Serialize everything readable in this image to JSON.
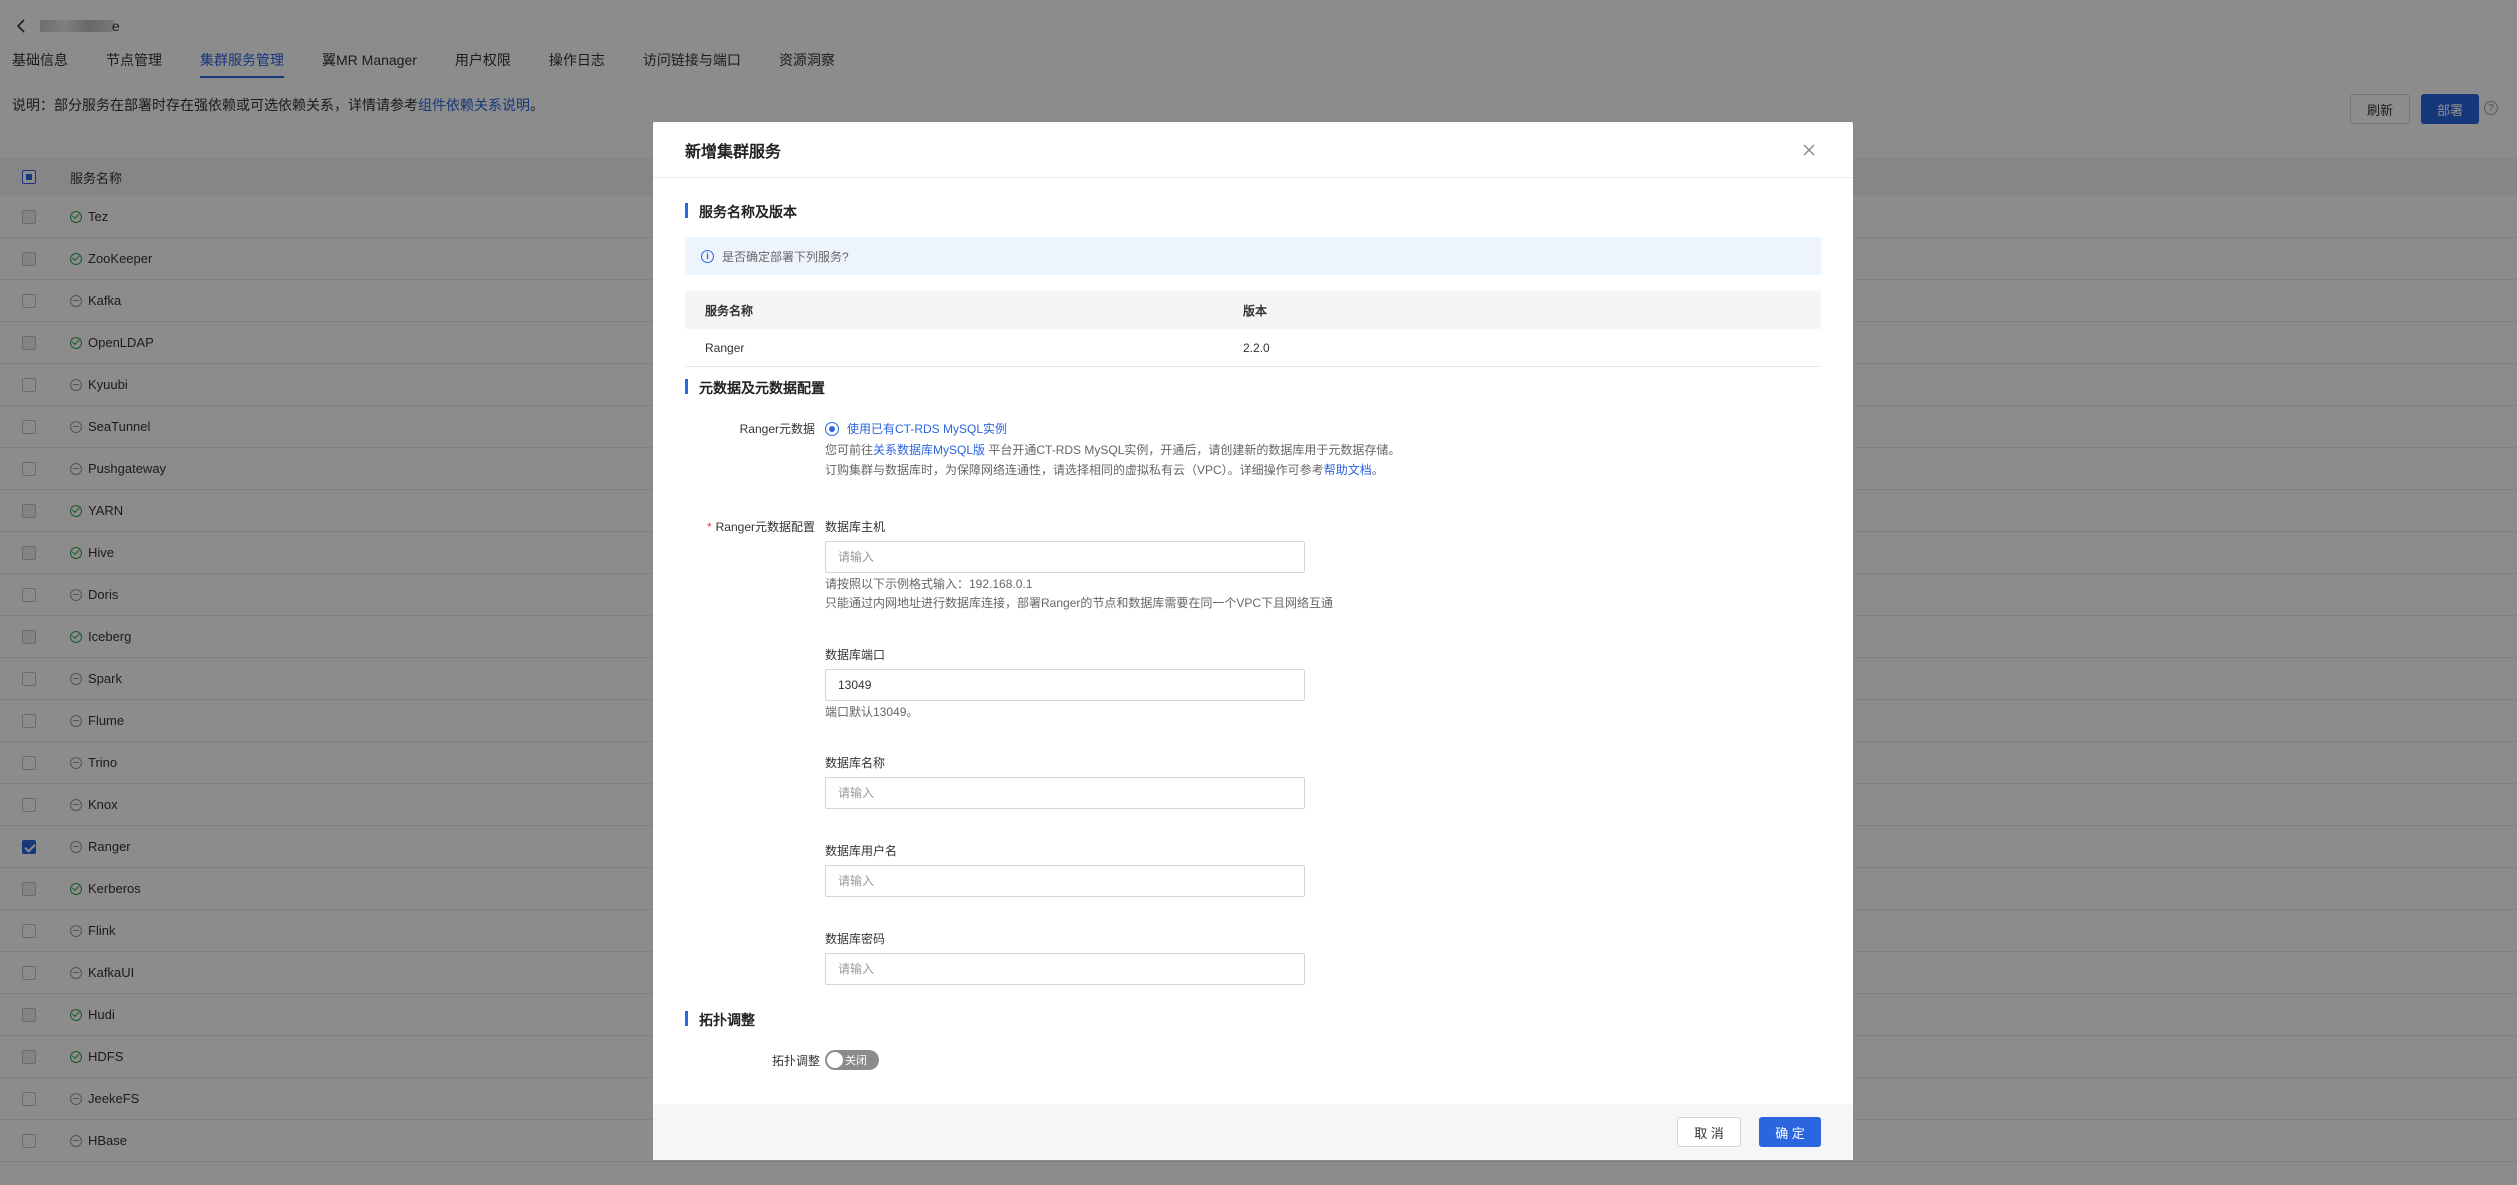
{
  "page": {
    "title_masked": "e",
    "tabs": [
      "基础信息",
      "节点管理",
      "集群服务管理",
      "翼MR Manager",
      "用户权限",
      "操作日志",
      "访问链接与端口",
      "资源洞察"
    ],
    "active_tab_index": 2,
    "description_prefix": "说明：部分服务在部署时存在强依赖或可选依赖关系，详情请参考",
    "description_link": "组件依赖关系说明",
    "description_suffix": "。",
    "refresh_label": "刷新",
    "deploy_label": "部署",
    "table_header": "服务名称",
    "services": [
      {
        "name": "Tez",
        "status": "ok",
        "checkbox": "disabled"
      },
      {
        "name": "ZooKeeper",
        "status": "ok",
        "checkbox": "disabled"
      },
      {
        "name": "Kafka",
        "status": "off",
        "checkbox": "empty"
      },
      {
        "name": "OpenLDAP",
        "status": "ok",
        "checkbox": "disabled"
      },
      {
        "name": "Kyuubi",
        "status": "off",
        "checkbox": "empty"
      },
      {
        "name": "SeaTunnel",
        "status": "off",
        "checkbox": "empty"
      },
      {
        "name": "Pushgateway",
        "status": "off",
        "checkbox": "empty"
      },
      {
        "name": "YARN",
        "status": "ok",
        "checkbox": "disabled"
      },
      {
        "name": "Hive",
        "status": "ok",
        "checkbox": "disabled"
      },
      {
        "name": "Doris",
        "status": "off",
        "checkbox": "empty"
      },
      {
        "name": "Iceberg",
        "status": "ok",
        "checkbox": "disabled"
      },
      {
        "name": "Spark",
        "status": "off",
        "checkbox": "empty"
      },
      {
        "name": "Flume",
        "status": "off",
        "checkbox": "empty"
      },
      {
        "name": "Trino",
        "status": "off",
        "checkbox": "empty"
      },
      {
        "name": "Knox",
        "status": "off",
        "checkbox": "empty"
      },
      {
        "name": "Ranger",
        "status": "off",
        "checkbox": "checked"
      },
      {
        "name": "Kerberos",
        "status": "ok",
        "checkbox": "disabled"
      },
      {
        "name": "Flink",
        "status": "off",
        "checkbox": "empty"
      },
      {
        "name": "KafkaUI",
        "status": "off",
        "checkbox": "empty"
      },
      {
        "name": "Hudi",
        "status": "ok",
        "checkbox": "disabled"
      },
      {
        "name": "HDFS",
        "status": "ok",
        "checkbox": "disabled"
      },
      {
        "name": "JeekeFS",
        "status": "off",
        "checkbox": "empty"
      },
      {
        "name": "HBase",
        "status": "off",
        "checkbox": "empty"
      }
    ]
  },
  "modal": {
    "title": "新增集群服务",
    "section1_title": "服务名称及版本",
    "confirm_text": "是否确定部署下列服务?",
    "table_headers": {
      "name": "服务名称",
      "version": "版本"
    },
    "rows": [
      {
        "name": "Ranger",
        "version": "2.2.0"
      }
    ],
    "section2_title": "元数据及元数据配置",
    "meta_label": "Ranger元数据",
    "radio_label": "使用已有CT-RDS MySQL实例",
    "hint1_prefix": "您可前往",
    "hint1_link": "关系数据库MySQL版",
    "hint1_suffix": " 平台开通CT-RDS MySQL实例，开通后，请创建新的数据库用于元数据存储。",
    "hint2_prefix": "订购集群与数据库时，为保障网络连通性，请选择相同的虚拟私有云（VPC）。详细操作可参考",
    "hint2_link": "帮助文档",
    "hint2_suffix": "。",
    "config_label": "Ranger元数据配置",
    "config_required": "*",
    "fields": {
      "host": {
        "label": "数据库主机",
        "placeholder": "请输入",
        "value": "",
        "hint1": "请按照以下示例格式输入：192.168.0.1",
        "hint2": "只能通过内网地址进行数据库连接，部署Ranger的节点和数据库需要在同一个VPC下且网络互通"
      },
      "port": {
        "label": "数据库端口",
        "placeholder": "请输入",
        "value": "13049",
        "hint1": "端口默认13049。"
      },
      "dbname": {
        "label": "数据库名称",
        "placeholder": "请输入",
        "value": ""
      },
      "username": {
        "label": "数据库用户名",
        "placeholder": "请输入",
        "value": ""
      },
      "password": {
        "label": "数据库密码",
        "placeholder": "请输入",
        "value": ""
      }
    },
    "section3_title": "拓扑调整",
    "topology_label": "拓扑调整",
    "topology_toggle": "关闭",
    "topology_toggle_on": false,
    "cancel_label": "取 消",
    "ok_label": "确 定"
  },
  "colors": {
    "accent": "#2b65e0",
    "ok": "#2aa84a",
    "mask": "rgba(0,0,0,0.45)"
  }
}
